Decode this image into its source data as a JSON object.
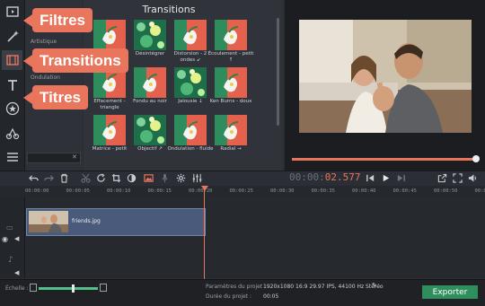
{
  "callouts": {
    "filters": "Filtres",
    "transitions": "Transitions",
    "titles": "Titres"
  },
  "categories": {
    "item1": "Artistique",
    "item2": "Ondulation"
  },
  "transitions_panel": {
    "title": "Transitions",
    "items": [
      {
        "label": "",
        "style": "leaf"
      },
      {
        "label": "Désintégrer",
        "style": "bokeh"
      },
      {
        "label": "Distorsion - 2 ondes ↙",
        "style": "leaf"
      },
      {
        "label": "Écoulement - petit ↑",
        "style": "leaf"
      },
      {
        "label": "Effacement - triangle",
        "style": "leaf"
      },
      {
        "label": "Fondu au noir",
        "style": "leaf"
      },
      {
        "label": "Jalousie ↓",
        "style": "bokeh"
      },
      {
        "label": "Ken Burns - doux",
        "style": "leaf"
      },
      {
        "label": "Matrice - petit",
        "style": "leaf"
      },
      {
        "label": "Objectif ↗",
        "style": "bokeh"
      },
      {
        "label": "Ondulation - fluide",
        "style": "leaf"
      },
      {
        "label": "Radial →",
        "style": "leaf"
      }
    ]
  },
  "timecode": {
    "lead": "00:00:",
    "value": "02.577"
  },
  "ruler": [
    "00:00:00",
    "00:00:05",
    "00:00:10",
    "00:00:15",
    "00:00:20",
    "00:00:25",
    "00:00:30",
    "00:00:35",
    "00:00:40",
    "00:00:45",
    "00:00:50",
    "00:00:55"
  ],
  "clip": {
    "name": "friends.jpg"
  },
  "footer": {
    "scale_label": "Échelle :",
    "params_label": "Paramètres du projet :",
    "params_value": "1920x1080 16:9 29.97 IPS, 44100 Hz Stéréo",
    "duration_label": "Durée du projet :",
    "duration_value": "00:05",
    "export_label": "Exporter"
  },
  "preview": {
    "progress": 1.0
  },
  "colors": {
    "accent": "#e8755c",
    "clip": "#4a5a7a",
    "export": "#2f8f5c"
  }
}
